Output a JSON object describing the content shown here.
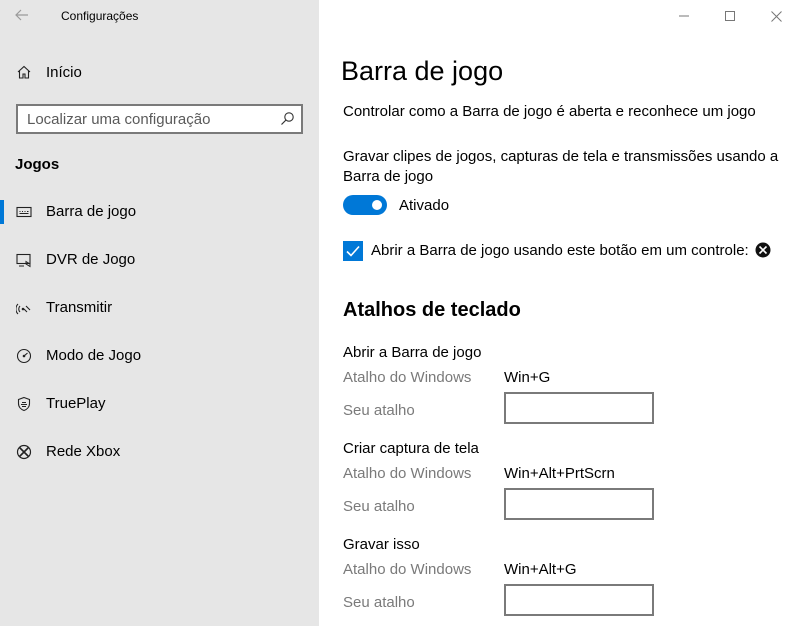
{
  "window": {
    "title": "Configurações",
    "controls": [
      "minimize-icon",
      "maximize-icon",
      "close-icon"
    ]
  },
  "sidebar": {
    "home_label": "Início",
    "search": {
      "placeholder": "Localizar uma configuração",
      "value": ""
    },
    "section_heading": "Jogos",
    "items": [
      {
        "label": "Barra de jogo",
        "icon": "game-bar-icon",
        "active": true
      },
      {
        "label": "DVR de Jogo",
        "icon": "game-dvr-icon",
        "active": false
      },
      {
        "label": "Transmitir",
        "icon": "broadcast-icon",
        "active": false
      },
      {
        "label": "Modo de Jogo",
        "icon": "game-mode-icon",
        "active": false
      },
      {
        "label": "TruePlay",
        "icon": "trueplay-icon",
        "active": false
      },
      {
        "label": "Rede Xbox",
        "icon": "xbox-icon",
        "active": false
      }
    ]
  },
  "main": {
    "title": "Barra de jogo",
    "description": "Controlar como a Barra de jogo é aberta e reconhece um jogo",
    "record_setting": {
      "label": "Gravar clipes de jogos, capturas de tela e transmissões usando a Barra de jogo",
      "state_label": "Ativado",
      "on": true
    },
    "controller_setting": {
      "label": "Abrir a Barra de jogo usando este botão em um controle:",
      "checked": true
    },
    "shortcuts_heading": "Atalhos de teclado",
    "shortcuts": [
      {
        "title": "Abrir a Barra de jogo",
        "windows_label": "Atalho do Windows",
        "windows_value": "Win+G",
        "custom_label": "Seu atalho",
        "custom_value": ""
      },
      {
        "title": "Criar captura de tela",
        "windows_label": "Atalho do Windows",
        "windows_value": "Win+Alt+PrtScrn",
        "custom_label": "Seu atalho",
        "custom_value": ""
      },
      {
        "title": "Gravar isso",
        "windows_label": "Atalho do Windows",
        "windows_value": "Win+Alt+G",
        "custom_label": "Seu atalho",
        "custom_value": ""
      }
    ]
  },
  "colors": {
    "accent": "#0078d7",
    "sidebar_bg": "#e6e6e6",
    "muted_text": "#7a7a7a"
  }
}
